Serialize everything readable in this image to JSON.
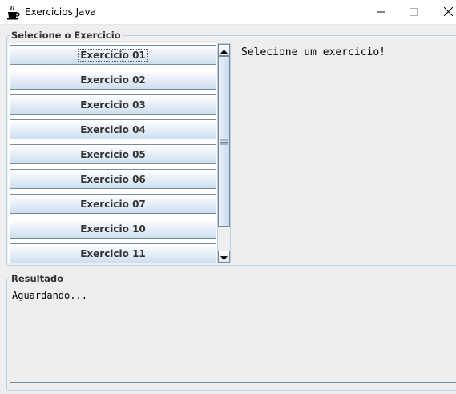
{
  "window": {
    "title": "Exercicios Java",
    "icon": "java-coffee-cup-icon",
    "controls": [
      "minimize-icon",
      "maximize-icon",
      "close-icon"
    ]
  },
  "select_panel": {
    "legend": "Selecione o Exercicio",
    "buttons": [
      {
        "label": "Exercicio 01",
        "focused": true
      },
      {
        "label": "Exercicio 02"
      },
      {
        "label": "Exercicio 03"
      },
      {
        "label": "Exercicio 04"
      },
      {
        "label": "Exercicio 05"
      },
      {
        "label": "Exercicio 06"
      },
      {
        "label": "Exercicio 07"
      },
      {
        "label": "Exercicio 10"
      },
      {
        "label": "Exercicio 11"
      }
    ],
    "message": "Selecione um exercicio!"
  },
  "result_panel": {
    "legend": "Resultado",
    "text": "Aguardando..."
  },
  "colors": {
    "border": "#b8cfe5",
    "button_gradient_bottom": "#cddff0",
    "background": "#eeeeee"
  }
}
